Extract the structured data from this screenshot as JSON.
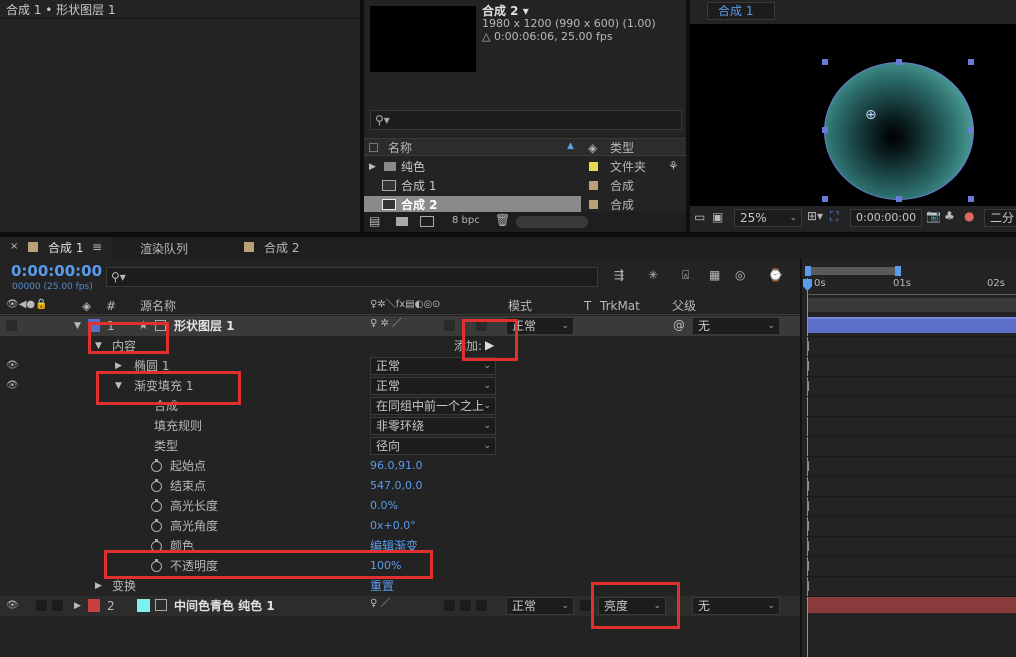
{
  "top_left": {
    "breadcrumb": "合成 1 • 形状图层 1"
  },
  "project": {
    "comp_name": "合成 2",
    "dims": "1980 x 1200  (990 x 600) (1.00)",
    "duration": "△ 0:00:06:06, 25.00 fps",
    "search_placeholder": "",
    "col_name": "名称",
    "col_type": "类型",
    "items": [
      {
        "name": "纯色",
        "type": "文件夹",
        "color": "#e8d84a"
      },
      {
        "name": "合成 1",
        "type": "合成",
        "color": "#b8a078"
      },
      {
        "name": "合成 2",
        "type": "合成",
        "color": "#b8a078"
      }
    ],
    "bpc": "8 bpc"
  },
  "viewer": {
    "tab": "合成 1",
    "zoom": "25%",
    "time": "0:00:00:00",
    "view_label": "二分"
  },
  "timeline": {
    "tabs": [
      {
        "label": "合成 1"
      },
      {
        "label": "渲染队列"
      },
      {
        "label": "合成 2"
      }
    ],
    "timecode": "0:00:00:00",
    "fps": "00000 (25.00 fps)",
    "headers": {
      "source": "源名称",
      "mode": "模式",
      "t": "T",
      "trkmat": "TrkMat",
      "parent": "父级"
    },
    "ruler": {
      "r0": "0s",
      "r1": "01s",
      "r2": "02s"
    },
    "layer1": {
      "num": "1",
      "name": "形状图层 1",
      "mode": "正常",
      "parent": "无"
    },
    "contents": "内容",
    "add_label": "添加:",
    "ellipse": "椭圆 1",
    "ellipse_mode": "正常",
    "grad": "渐变填充 1",
    "grad_mode": "正常",
    "composite": "合成",
    "composite_val": "在同组中前一个之上",
    "fill_rule": "填充规则",
    "fill_rule_val": "非零环绕",
    "type": "类型",
    "type_val": "径向",
    "start": "起始点",
    "start_val": "96.0,91.0",
    "end": "结束点",
    "end_val": "547.0,0.0",
    "hl_len": "高光长度",
    "hl_len_val": "0.0%",
    "hl_ang": "高光角度",
    "hl_ang_val": "0x+0.0°",
    "colors": "颜色",
    "colors_val": "编辑渐变",
    "opacity": "不透明度",
    "opacity_val": "100%",
    "transform": "变换",
    "transform_val": "重置",
    "layer2": {
      "num": "2",
      "name": "中间色青色 纯色 1",
      "mode": "正常",
      "trkmat": "亮度",
      "parent": "无"
    }
  },
  "colors": {
    "accent": "#5a9bea",
    "red": "#e03030",
    "layer1_bar": "#5b6fc9",
    "layer2_bar": "#8a3c3c"
  }
}
